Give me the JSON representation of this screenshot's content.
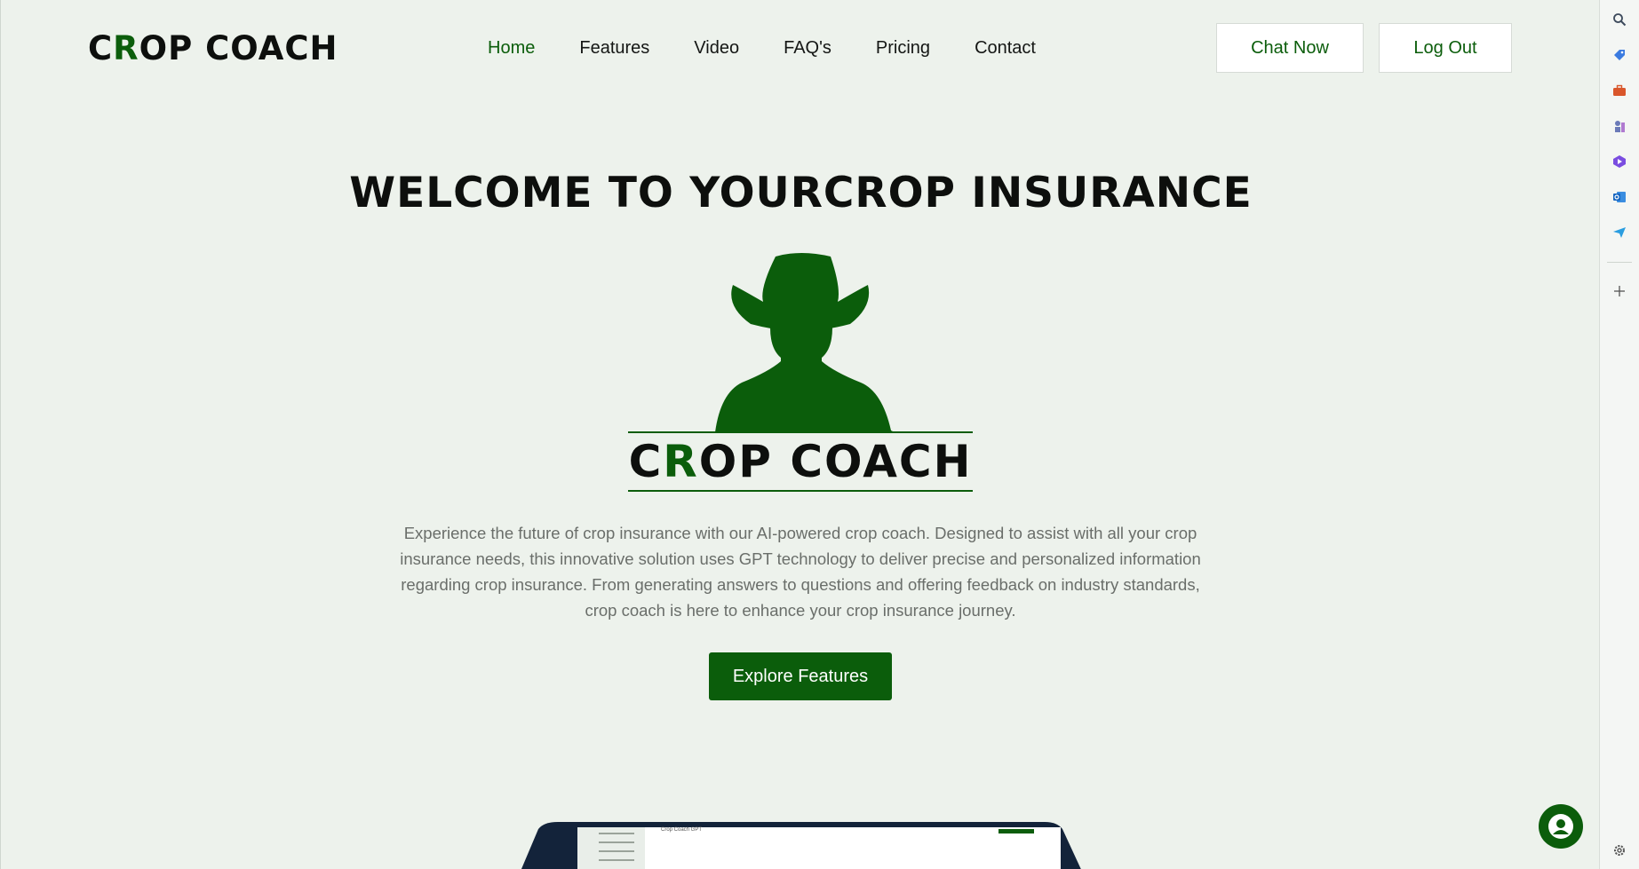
{
  "brand": {
    "logo_prefix": "C",
    "logo_r": "R",
    "logo_rest": "OP COACH"
  },
  "nav": {
    "items": [
      {
        "label": "Home",
        "active": true
      },
      {
        "label": "Features"
      },
      {
        "label": "Video"
      },
      {
        "label": "FAQ's"
      },
      {
        "label": "Pricing"
      },
      {
        "label": "Contact"
      }
    ]
  },
  "header": {
    "chat_now": "Chat Now",
    "log_out": "Log Out"
  },
  "hero": {
    "title": "WELCOME TO YOURCROP INSURANCE",
    "logo_prefix": "C",
    "logo_r": "R",
    "logo_rest": "OP COACH",
    "description": "Experience the future of crop insurance with our AI-powered crop coach. Designed to assist with all your crop insurance needs, this innovative solution uses GPT technology to deliver precise and personalized information regarding crop insurance. From generating answers to questions and offering feedback on industry standards, crop coach is here to enhance your crop insurance journey.",
    "cta": "Explore Features"
  },
  "device_preview": {
    "app_title": "Crop Coach GPT"
  },
  "colors": {
    "brand_green": "#0b5d0b",
    "background": "#edf2ec",
    "text_dark": "#0d0f0d"
  },
  "sidebar_icons": [
    "search-icon",
    "tag-icon",
    "briefcase-icon",
    "chess-icon",
    "copilot-icon",
    "outlook-icon",
    "send-icon",
    "plus-icon",
    "settings-icon"
  ]
}
